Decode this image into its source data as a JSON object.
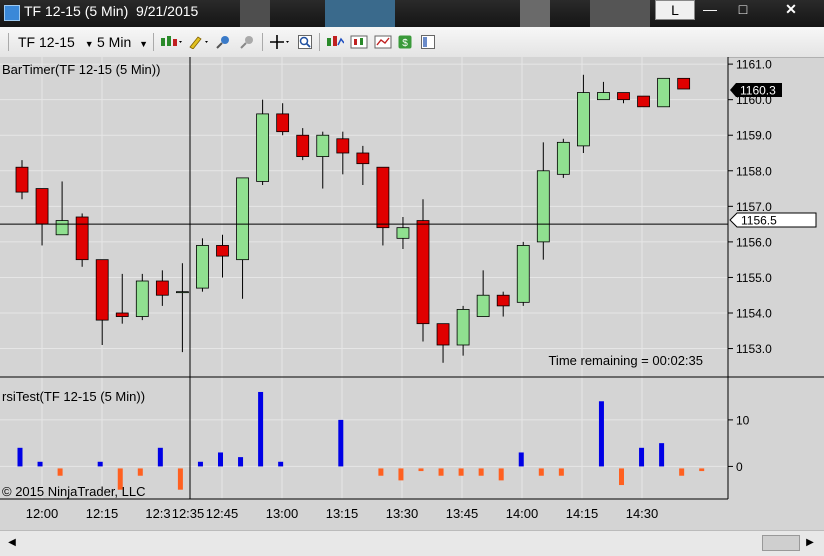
{
  "window": {
    "title": "TF 12-15 (5 Min)  9/21/2015",
    "btn_l": "L",
    "btn_min": "—",
    "btn_max": "□",
    "btn_close": "✕"
  },
  "toolbar": {
    "instrument": "TF 12-15",
    "period": "5 Min",
    "icons": [
      "bar-style-icon",
      "draw-pencil-icon",
      "pin-icon",
      "delete-pin-icon",
      "crosshair-icon",
      "zoom-icon",
      "indicators-icon",
      "strategies-icon",
      "properties-icon",
      "dollar-icon",
      "data-box-icon"
    ]
  },
  "colors": {
    "up": "#90e090",
    "down": "#e00000",
    "rsi_pos": "#0000e6",
    "rsi_neg": "#ff6020",
    "background": "#d4d4d4",
    "grid": "#e6e6e6"
  },
  "price_panel_label": "BarTimer(TF 12-15 (5 Min))",
  "rsi_panel_label": "rsiTest(TF 12-15 (5 Min))",
  "time_remaining": "Time remaining = 00:02:35",
  "copyright": "© 2015 NinjaTrader, LLC",
  "last_price_label": "1160.3",
  "crosshair_price_label": "1156.5",
  "chart_data": [
    {
      "type": "candlestick",
      "title": "BarTimer(TF 12-15 (5 Min))",
      "ylim": [
        1152.2,
        1161.2
      ],
      "yticks": [
        1153.0,
        1154.0,
        1155.0,
        1156.0,
        1157.0,
        1158.0,
        1159.0,
        1160.0,
        1161.0
      ],
      "x_tick_labels": [
        "12:00",
        "12:15",
        "12:3",
        "12:35",
        "12:45",
        "13:00",
        "13:15",
        "13:30",
        "13:45",
        "14:00",
        "14:15",
        "14:30"
      ],
      "last_price": 1160.3,
      "crosshair_price": 1156.5,
      "crosshair_time": "12:35",
      "bars": [
        {
          "open": 1158.1,
          "high": 1158.3,
          "low": 1157.2,
          "close": 1157.4
        },
        {
          "open": 1157.5,
          "high": 1157.5,
          "low": 1155.9,
          "close": 1156.5
        },
        {
          "open": 1156.2,
          "high": 1157.7,
          "low": 1156.2,
          "close": 1156.6
        },
        {
          "open": 1156.7,
          "high": 1156.8,
          "low": 1155.3,
          "close": 1155.5
        },
        {
          "open": 1155.5,
          "high": 1155.5,
          "low": 1153.1,
          "close": 1153.8
        },
        {
          "open": 1154.0,
          "high": 1155.1,
          "low": 1153.7,
          "close": 1153.9
        },
        {
          "open": 1153.9,
          "high": 1155.1,
          "low": 1153.8,
          "close": 1154.9
        },
        {
          "open": 1154.9,
          "high": 1155.2,
          "low": 1154.2,
          "close": 1154.5
        },
        {
          "open": 1154.6,
          "high": 1155.4,
          "low": 1152.9,
          "close": 1154.6
        },
        {
          "open": 1154.7,
          "high": 1156.1,
          "low": 1154.6,
          "close": 1155.9
        },
        {
          "open": 1155.9,
          "high": 1156.2,
          "low": 1155.0,
          "close": 1155.6
        },
        {
          "open": 1155.5,
          "high": 1156.3,
          "low": 1154.4,
          "close": 1157.8
        },
        {
          "open": 1157.7,
          "high": 1160.0,
          "low": 1157.6,
          "close": 1159.6
        },
        {
          "open": 1159.6,
          "high": 1159.9,
          "low": 1159.0,
          "close": 1159.1
        },
        {
          "open": 1159.0,
          "high": 1159.2,
          "low": 1158.3,
          "close": 1158.4
        },
        {
          "open": 1158.4,
          "high": 1159.1,
          "low": 1157.5,
          "close": 1159.0
        },
        {
          "open": 1158.9,
          "high": 1159.1,
          "low": 1157.9,
          "close": 1158.5
        },
        {
          "open": 1158.5,
          "high": 1158.7,
          "low": 1157.6,
          "close": 1158.2
        },
        {
          "open": 1158.1,
          "high": 1158.1,
          "low": 1155.9,
          "close": 1156.4
        },
        {
          "open": 1156.1,
          "high": 1156.7,
          "low": 1155.8,
          "close": 1156.4
        },
        {
          "open": 1156.6,
          "high": 1157.2,
          "low": 1153.2,
          "close": 1153.7
        },
        {
          "open": 1153.7,
          "high": 1153.7,
          "low": 1152.6,
          "close": 1153.1
        },
        {
          "open": 1153.1,
          "high": 1154.2,
          "low": 1152.8,
          "close": 1154.1
        },
        {
          "open": 1153.9,
          "high": 1155.2,
          "low": 1153.9,
          "close": 1154.5
        },
        {
          "open": 1154.5,
          "high": 1154.6,
          "low": 1153.9,
          "close": 1154.2
        },
        {
          "open": 1154.3,
          "high": 1156.0,
          "low": 1154.2,
          "close": 1155.9
        },
        {
          "open": 1156.0,
          "high": 1158.8,
          "low": 1155.5,
          "close": 1158.0
        },
        {
          "open": 1157.9,
          "high": 1158.9,
          "low": 1157.8,
          "close": 1158.8
        },
        {
          "open": 1158.7,
          "high": 1160.7,
          "low": 1158.5,
          "close": 1160.2
        },
        {
          "open": 1160.0,
          "high": 1160.5,
          "low": 1160.0,
          "close": 1160.2
        },
        {
          "open": 1160.2,
          "high": 1160.2,
          "low": 1159.9,
          "close": 1160.0
        },
        {
          "open": 1160.1,
          "high": 1160.1,
          "low": 1159.8,
          "close": 1159.8
        },
        {
          "open": 1159.8,
          "high": 1160.6,
          "low": 1159.8,
          "close": 1160.6
        },
        {
          "open": 1160.6,
          "high": 1160.6,
          "low": 1160.3,
          "close": 1160.3
        }
      ]
    },
    {
      "type": "bar",
      "title": "rsiTest(TF 12-15 (5 Min))",
      "ylim": [
        -7,
        19
      ],
      "yticks": [
        0,
        10
      ],
      "values": [
        4,
        1,
        -2,
        0,
        1,
        -5,
        -2,
        4,
        -5,
        1,
        3,
        2,
        16,
        1,
        0,
        0,
        10,
        0,
        -2,
        -3,
        -1,
        -2,
        -2,
        -2,
        -3,
        3,
        -2,
        -2,
        0,
        14,
        -4,
        4,
        5,
        -2,
        -1
      ]
    }
  ]
}
